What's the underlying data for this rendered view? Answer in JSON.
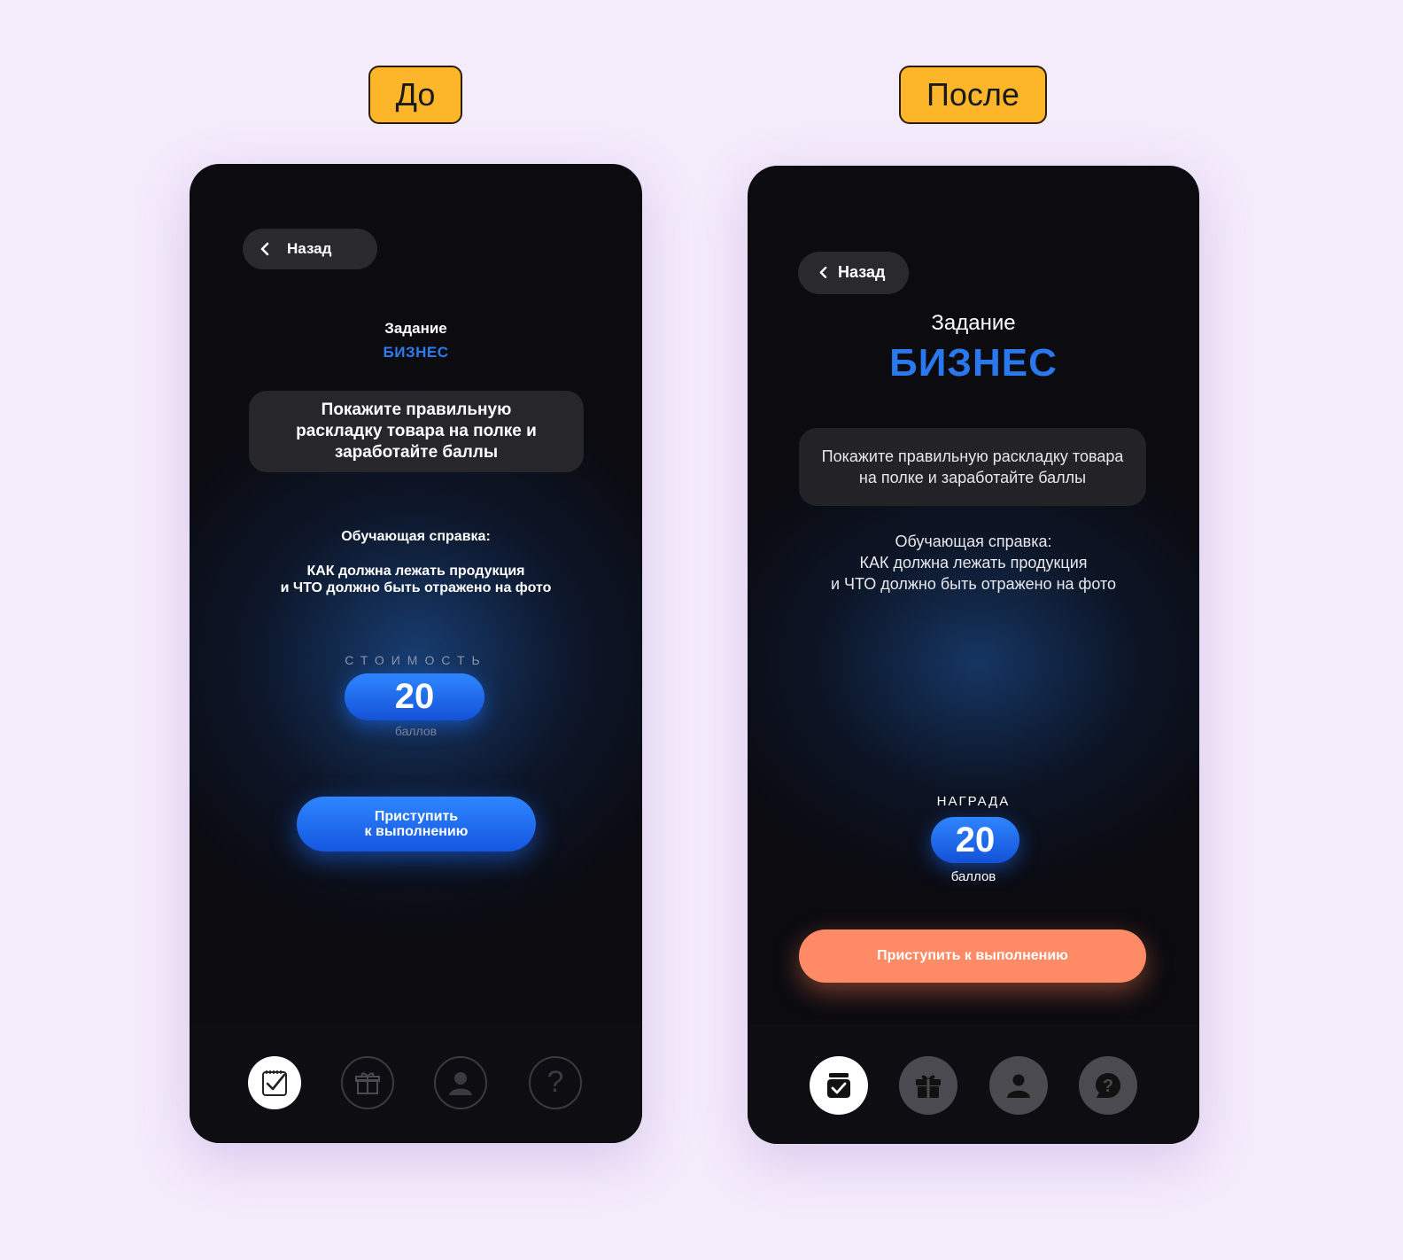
{
  "labels": {
    "before": "До",
    "after": "После"
  },
  "before": {
    "back_label": "Назад",
    "task_title": "Задание",
    "task_category": "БИЗНЕС",
    "description": "Покажите правильную раскладку товара на полке и заработайте баллы",
    "help_title": "Обучающая справка:",
    "help_line1": "КАК должна лежать продукция",
    "help_line2": "и ЧТО должно быть отражено на фото",
    "cost_label": "СТОИМОСТЬ",
    "points_value": "20",
    "points_unit": "баллов",
    "start_line1": "Приступить",
    "start_line2": "к выполнению",
    "nav": [
      "tasks-icon",
      "gift-icon",
      "profile-icon",
      "help-icon"
    ]
  },
  "after": {
    "back_label": "Назад",
    "task_title": "Задание",
    "task_category": "БИЗНЕС",
    "description_line1": "Покажите правильную раскладку товара",
    "description_line2": "на полке и заработайте баллы",
    "help_title": "Обучающая справка:",
    "help_line1": "КАК должна лежать продукция",
    "help_line2": "и ЧТО должно быть отражено на фото",
    "reward_label": "НАГРАДА",
    "points_value": "20",
    "points_unit": "баллов",
    "start_label": "Приступить к выполнению",
    "nav": [
      "tasks-icon",
      "gift-icon",
      "profile-icon",
      "help-icon"
    ]
  },
  "colors": {
    "page_bg": "#f4ebfb",
    "tag_bg": "#fdb52a",
    "phone_bg": "#0b0b10",
    "accent_blue": "#2a78ee",
    "cta_orange": "#ff8a66"
  }
}
